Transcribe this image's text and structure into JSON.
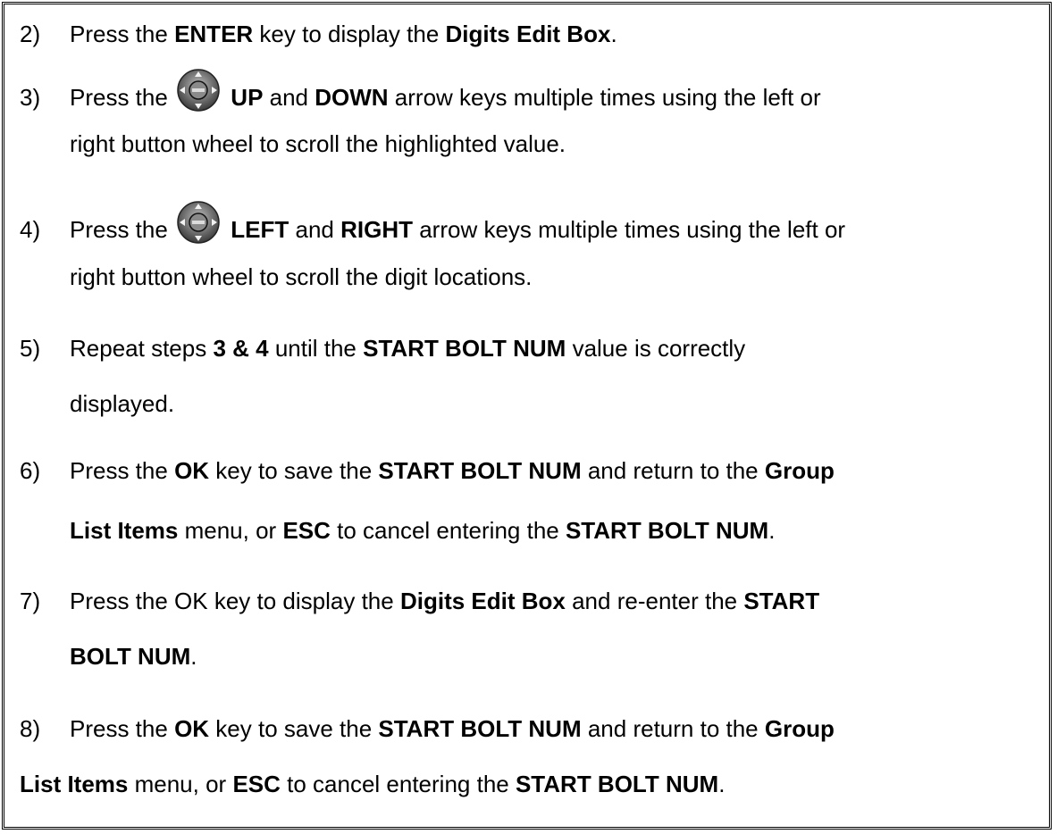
{
  "steps": [
    {
      "number": "2)",
      "lines": [
        [
          {
            "t": "Press the ",
            "b": false
          },
          {
            "t": "ENTER",
            "b": true
          },
          {
            "t": " key to display the ",
            "b": false
          },
          {
            "t": "Digits Edit Box",
            "b": true
          },
          {
            "t": ".",
            "b": false
          }
        ]
      ]
    },
    {
      "number": "3)",
      "icon": "dpad-enter-icon",
      "lines": [
        [
          {
            "t": "Press the ",
            "b": false
          },
          {
            "icon": true
          },
          {
            "t": " UP",
            "b": true
          },
          {
            "t": " and ",
            "b": false
          },
          {
            "t": "DOWN",
            "b": true
          },
          {
            "t": " arrow keys multiple times using the left or",
            "b": false
          }
        ],
        [
          {
            "t": "right button wheel to scroll the highlighted value.",
            "b": false
          }
        ]
      ]
    },
    {
      "number": "4)",
      "icon": "dpad-enter-icon",
      "lines": [
        [
          {
            "t": "Press the ",
            "b": false
          },
          {
            "icon": true
          },
          {
            "t": " LEFT",
            "b": true
          },
          {
            "t": " and ",
            "b": false
          },
          {
            "t": "RIGHT",
            "b": true
          },
          {
            "t": " arrow keys multiple times using the left or",
            "b": false
          }
        ],
        [
          {
            "t": "right button wheel to scroll the digit locations.",
            "b": false
          }
        ]
      ]
    },
    {
      "number": "5)",
      "lines": [
        [
          {
            "t": "Repeat steps ",
            "b": false
          },
          {
            "t": "3 & 4",
            "b": true
          },
          {
            "t": " until the ",
            "b": false
          },
          {
            "t": "START BOLT NUM",
            "b": true
          },
          {
            "t": " value is correctly",
            "b": false
          }
        ],
        [
          {
            "t": "displayed.",
            "b": false
          }
        ]
      ]
    },
    {
      "number": "6)",
      "lines": [
        [
          {
            "t": "Press the ",
            "b": false
          },
          {
            "t": "OK",
            "b": true
          },
          {
            "t": " key to save the ",
            "b": false
          },
          {
            "t": "START BOLT NUM",
            "b": true
          },
          {
            "t": " and return to the ",
            "b": false
          },
          {
            "t": "Group",
            "b": true
          }
        ],
        [
          {
            "t": "List Items",
            "b": true
          },
          {
            "t": " menu, or ",
            "b": false
          },
          {
            "t": "ESC",
            "b": true
          },
          {
            "t": " to cancel entering the ",
            "b": false
          },
          {
            "t": "START BOLT NUM",
            "b": true
          },
          {
            "t": ".",
            "b": false
          }
        ]
      ]
    },
    {
      "number": "7)",
      "lines": [
        [
          {
            "t": "Press the OK key to display the ",
            "b": false
          },
          {
            "t": "Digits Edit Box",
            "b": true
          },
          {
            "t": " and re-enter the ",
            "b": false
          },
          {
            "t": "START",
            "b": true
          }
        ],
        [
          {
            "t": "BOLT NUM",
            "b": true
          },
          {
            "t": ".",
            "b": false
          }
        ]
      ]
    },
    {
      "number": "8)",
      "flush": true,
      "lines": [
        [
          {
            "t": "Press the ",
            "b": false
          },
          {
            "t": "OK",
            "b": true
          },
          {
            "t": " key to save the ",
            "b": false
          },
          {
            "t": "START BOLT NUM",
            "b": true
          },
          {
            "t": " and return to the ",
            "b": false
          },
          {
            "t": "Group",
            "b": true
          }
        ],
        [
          {
            "t": "List Items",
            "b": true
          },
          {
            "t": " menu, or ",
            "b": false
          },
          {
            "t": "ESC",
            "b": true
          },
          {
            "t": " to cancel entering the ",
            "b": false
          },
          {
            "t": "START BOLT NUM",
            "b": true
          },
          {
            "t": ".",
            "b": false
          }
        ]
      ]
    }
  ]
}
